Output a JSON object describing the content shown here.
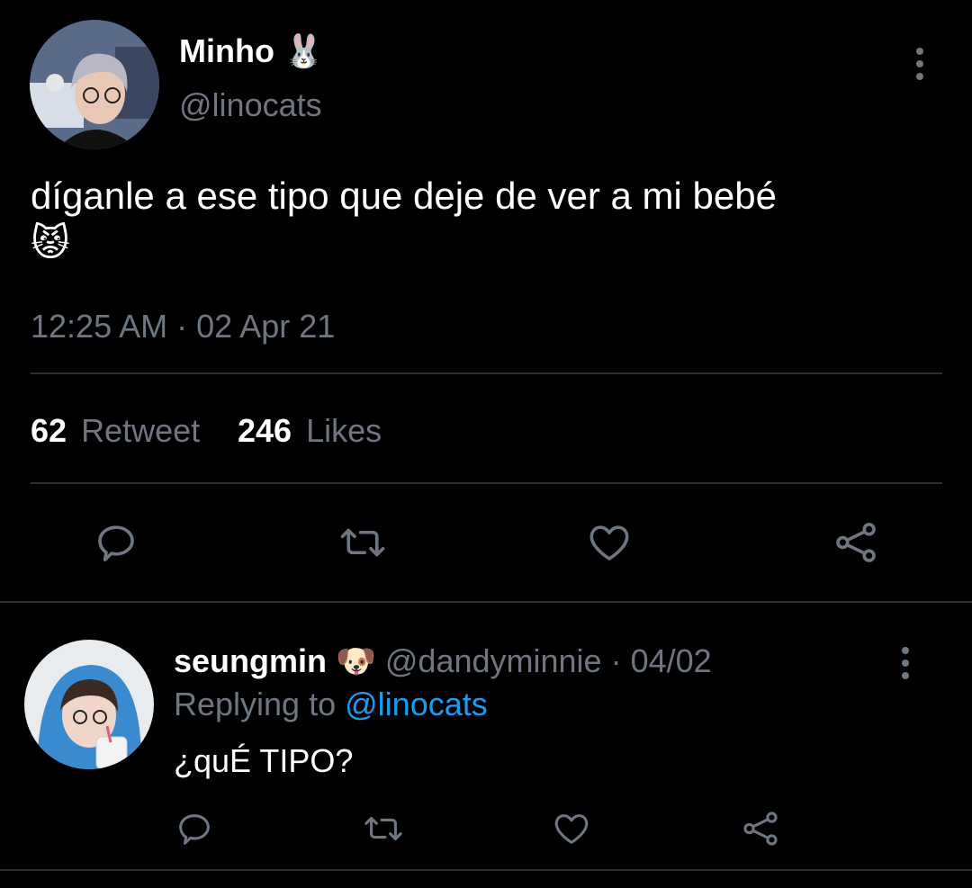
{
  "main_tweet": {
    "display_name": "Minho",
    "name_emoji": "🐰",
    "handle": "@linocats",
    "text": "díganle a ese tipo que deje de ver a mi bebé",
    "text_emoji": "😾",
    "time": "12:25 AM",
    "date_sep": "·",
    "date": "02 Apr 21",
    "retweet_count": "62",
    "retweet_label": "Retweet",
    "likes_count": "246",
    "likes_label": "Likes"
  },
  "reply": {
    "display_name": "seungmin",
    "name_emoji": "🐶",
    "handle": "@dandyminnie",
    "date_sep": "·",
    "date": "04/02",
    "replying_label": "Replying to",
    "replying_handle": "@linocats",
    "text": "¿quÉ TIPO?"
  },
  "icons": {
    "reply": "reply-icon",
    "retweet": "retweet-icon",
    "like": "heart-icon",
    "share": "share-icon",
    "more": "more-options-icon"
  },
  "colors": {
    "background": "#000000",
    "text": "#ffffff",
    "muted": "#6e7781",
    "link": "#1d9bf0",
    "divider": "#2a2f33"
  }
}
